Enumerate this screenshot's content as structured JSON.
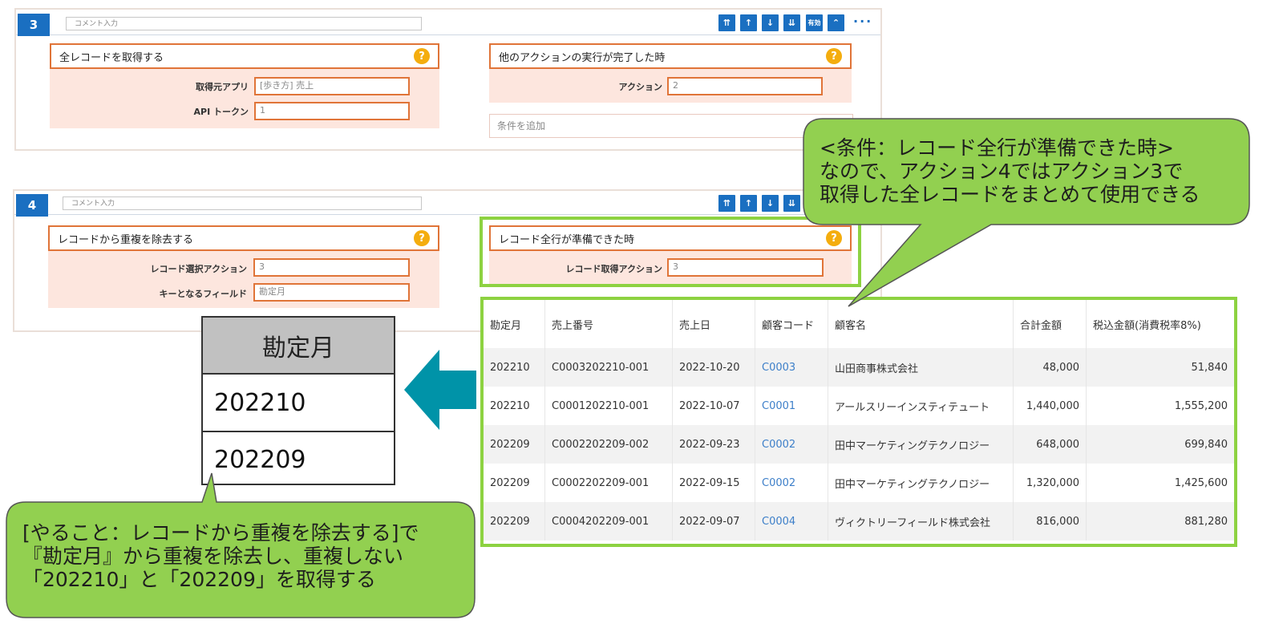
{
  "block3": {
    "number": "3",
    "comment_placeholder": "コメント入力",
    "toolbar": {
      "btn1": "⇈",
      "btn2": "↑",
      "btn3": "↓",
      "btn4": "⇊",
      "enabled": "有効",
      "collapse": "⌃",
      "more": "···"
    },
    "left_card": {
      "title": "全レコードを取得する",
      "help": "?",
      "fields": [
        {
          "label": "取得元アプリ",
          "value": "[歩き方] 売上"
        },
        {
          "label": "API トークン",
          "value": "1"
        }
      ]
    },
    "right_card": {
      "title": "他のアクションの実行が完了した時",
      "help": "?",
      "fields": [
        {
          "label": "アクション",
          "value": "2"
        }
      ],
      "add_condition": "条件を追加"
    }
  },
  "block4": {
    "number": "4",
    "comment_placeholder": "コメント入力",
    "toolbar": {
      "btn1": "⇈",
      "btn2": "↑",
      "btn3": "↓",
      "btn4": "⇊"
    },
    "left_card": {
      "title": "レコードから重複を除去する",
      "help": "?",
      "fields": [
        {
          "label": "レコード選択アクション",
          "value": "3"
        },
        {
          "label": "キーとなるフィールド",
          "value": "勘定月"
        }
      ]
    },
    "right_card": {
      "title": "レコード全行が準備できた時",
      "help": "?",
      "fields": [
        {
          "label": "レコード取得アクション",
          "value": "3"
        }
      ]
    }
  },
  "records_table": {
    "headers": [
      "勘定月",
      "売上番号",
      "売上日",
      "顧客コード",
      "顧客名",
      "合計金額",
      "税込金額(消費税率8%)"
    ],
    "rows": [
      [
        "202210",
        "C0003202210-001",
        "2022-10-20",
        "C0003",
        "山田商事株式会社",
        "48,000",
        "51,840"
      ],
      [
        "202210",
        "C0001202210-001",
        "2022-10-07",
        "C0001",
        "アールスリーインスティテュート",
        "1,440,000",
        "1,555,200"
      ],
      [
        "202209",
        "C0002202209-002",
        "2022-09-23",
        "C0002",
        "田中マーケティングテクノロジー",
        "648,000",
        "699,840"
      ],
      [
        "202209",
        "C0002202209-001",
        "2022-09-15",
        "C0002",
        "田中マーケティングテクノロジー",
        "1,320,000",
        "1,425,600"
      ],
      [
        "202209",
        "C0004202209-001",
        "2022-09-07",
        "C0004",
        "ヴィクトリーフィールド株式会社",
        "816,000",
        "881,280"
      ]
    ]
  },
  "result_table": {
    "header": "勘定月",
    "values": [
      "202210",
      "202209"
    ]
  },
  "callout_top": {
    "lines": [
      "<条件：レコード全行が準備できた時>",
      "なので、アクション4ではアクション3で",
      "取得した全レコードをまとめて使用できる"
    ]
  },
  "callout_bottom": {
    "lines": [
      "[やること：レコードから重複を除去する]で",
      "『勘定月』から重複を除去し、重複しない",
      "「202210」と「202209」を取得する"
    ]
  },
  "colors": {
    "accent_blue": "#1a6fc1",
    "orange_border": "#e07438",
    "pink_fill": "#fde6de",
    "green_highlight": "#8dd241",
    "callout_fill": "#92d050",
    "arrow_teal": "#0093a8"
  }
}
